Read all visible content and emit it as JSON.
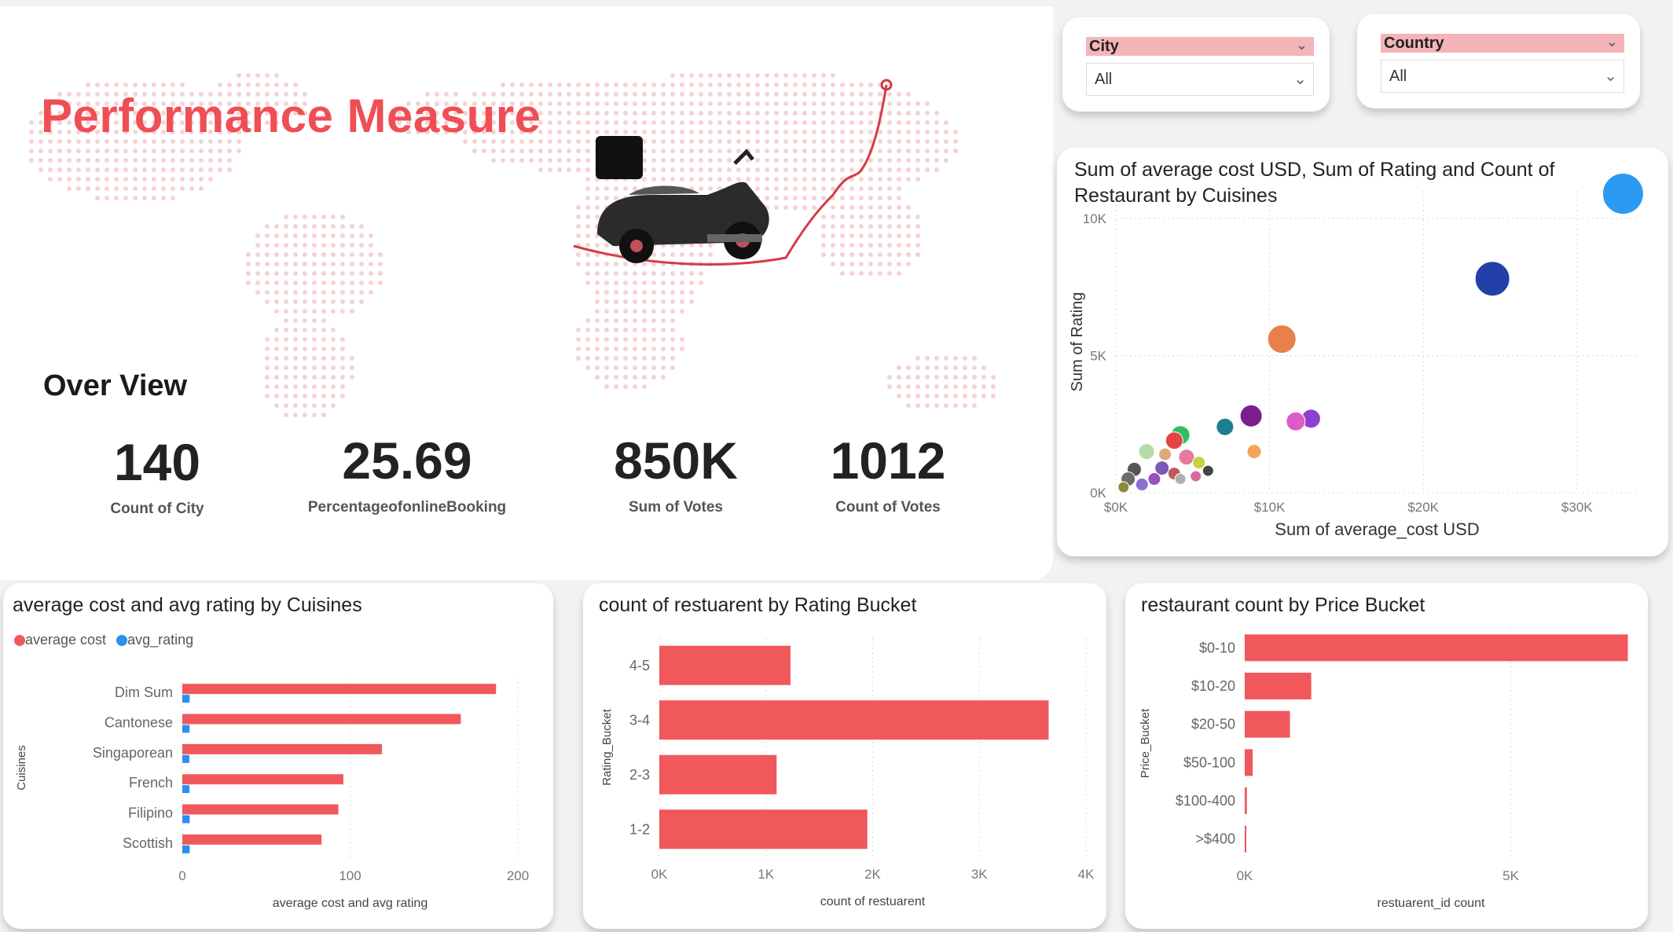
{
  "header": {
    "title": "Performance Measure",
    "overview": "Over View"
  },
  "kpis": [
    {
      "value": "140",
      "label": "Count of City"
    },
    {
      "value": "25.69",
      "label": "PercentageofonlineBooking"
    },
    {
      "value": "850K",
      "label": "Sum of Votes"
    },
    {
      "value": "1012",
      "label": "Count of Votes"
    }
  ],
  "slicers": {
    "city": {
      "label": "City",
      "value": "All"
    },
    "country": {
      "label": "Country",
      "value": "All"
    }
  },
  "colors": {
    "accent": "#f04e55",
    "bar": "#f0585c",
    "blue": "#2b8ef0",
    "grid": "#dddddd"
  },
  "chart_data": [
    {
      "id": "scatter",
      "type": "scatter",
      "title": "Sum of average cost USD, Sum of Rating and Count of Restaurant by Cuisines",
      "xlabel": "Sum of average_cost USD",
      "ylabel": "Sum of Rating",
      "xlim": [
        0,
        34000
      ],
      "ylim": [
        0,
        11000
      ],
      "xticks": [
        {
          "v": 0,
          "t": "$0K"
        },
        {
          "v": 10000,
          "t": "$10K"
        },
        {
          "v": 20000,
          "t": "$20K"
        },
        {
          "v": 30000,
          "t": "$30K"
        }
      ],
      "yticks": [
        {
          "v": 0,
          "t": "0K"
        },
        {
          "v": 5000,
          "t": "5K"
        },
        {
          "v": 10000,
          "t": "10K"
        }
      ],
      "points": [
        {
          "x": 33000,
          "y": 10900,
          "r": 26,
          "c": "#2b9af3"
        },
        {
          "x": 24500,
          "y": 7800,
          "r": 22,
          "c": "#233fa8"
        },
        {
          "x": 10800,
          "y": 5600,
          "r": 18,
          "c": "#e8804a"
        },
        {
          "x": 8800,
          "y": 2800,
          "r": 14,
          "c": "#7a1f8e"
        },
        {
          "x": 12700,
          "y": 2700,
          "r": 12,
          "c": "#8c3fd0"
        },
        {
          "x": 11700,
          "y": 2600,
          "r": 12,
          "c": "#e05ac6"
        },
        {
          "x": 7100,
          "y": 2400,
          "r": 11,
          "c": "#1e7f8e"
        },
        {
          "x": 9000,
          "y": 1500,
          "r": 9,
          "c": "#f4a35a"
        },
        {
          "x": 4200,
          "y": 2100,
          "r": 12,
          "c": "#2fbf5a"
        },
        {
          "x": 3800,
          "y": 1900,
          "r": 11,
          "c": "#e64444"
        },
        {
          "x": 2000,
          "y": 1500,
          "r": 10,
          "c": "#b8d9a8"
        },
        {
          "x": 4600,
          "y": 1300,
          "r": 10,
          "c": "#e87aa0"
        },
        {
          "x": 5400,
          "y": 1100,
          "r": 8,
          "c": "#c9cf3e"
        },
        {
          "x": 1200,
          "y": 850,
          "r": 9,
          "c": "#555555"
        },
        {
          "x": 800,
          "y": 500,
          "r": 9,
          "c": "#6b6b6b"
        },
        {
          "x": 3000,
          "y": 900,
          "r": 9,
          "c": "#7a5ab8"
        },
        {
          "x": 2500,
          "y": 500,
          "r": 8,
          "c": "#9a4fc5"
        },
        {
          "x": 3800,
          "y": 700,
          "r": 8,
          "c": "#c05a5a"
        },
        {
          "x": 6000,
          "y": 800,
          "r": 7,
          "c": "#444444"
        },
        {
          "x": 1700,
          "y": 300,
          "r": 8,
          "c": "#8a6fcf"
        },
        {
          "x": 4200,
          "y": 500,
          "r": 7,
          "c": "#b0b0b0"
        },
        {
          "x": 5200,
          "y": 600,
          "r": 7,
          "c": "#d86b9b"
        },
        {
          "x": 3200,
          "y": 1400,
          "r": 8,
          "c": "#e0a87a"
        },
        {
          "x": 500,
          "y": 200,
          "r": 7,
          "c": "#8b8b3a"
        }
      ]
    },
    {
      "id": "cuisines",
      "type": "bar",
      "title": "average cost and avg rating by Cuisines",
      "xlabel": "average cost and avg rating",
      "ylabel": "Cuisines",
      "xlim": [
        0,
        200
      ],
      "xticks": [
        0,
        100,
        200
      ],
      "categories": [
        "Dim Sum",
        "Cantonese",
        "Singaporean",
        "French",
        "Filipino",
        "Scottish"
      ],
      "series": [
        {
          "name": "average cost",
          "values": [
            187,
            166,
            119,
            96,
            93,
            83
          ]
        },
        {
          "name": "avg_rating",
          "values": [
            4.4,
            4.3,
            4.2,
            4.3,
            4.4,
            4.4
          ]
        }
      ]
    },
    {
      "id": "rating",
      "type": "bar",
      "title": "count of restuarent by Rating Bucket",
      "xlabel": "count of restuarent",
      "ylabel": "Rating_Bucket",
      "xlim": [
        0,
        4000
      ],
      "xticks": [
        {
          "v": 0,
          "t": "0K"
        },
        {
          "v": 1000,
          "t": "1K"
        },
        {
          "v": 2000,
          "t": "2K"
        },
        {
          "v": 3000,
          "t": "3K"
        },
        {
          "v": 4000,
          "t": "4K"
        }
      ],
      "categories": [
        "4-5",
        "3-4",
        "2-3",
        "1-2"
      ],
      "values": [
        1230,
        3650,
        1100,
        1950
      ]
    },
    {
      "id": "price",
      "type": "bar",
      "title": "restaurant count by Price Bucket",
      "xlabel": "restuarent_id count",
      "ylabel": "Price_Bucket",
      "xlim": [
        0,
        7000
      ],
      "xticks": [
        {
          "v": 0,
          "t": "0K"
        },
        {
          "v": 5000,
          "t": "5K"
        }
      ],
      "categories": [
        "$0-10",
        "$10-20",
        "$20-50",
        "$50-100",
        "$100-400",
        ">$400"
      ],
      "values": [
        7200,
        1250,
        850,
        150,
        40,
        25
      ]
    }
  ]
}
